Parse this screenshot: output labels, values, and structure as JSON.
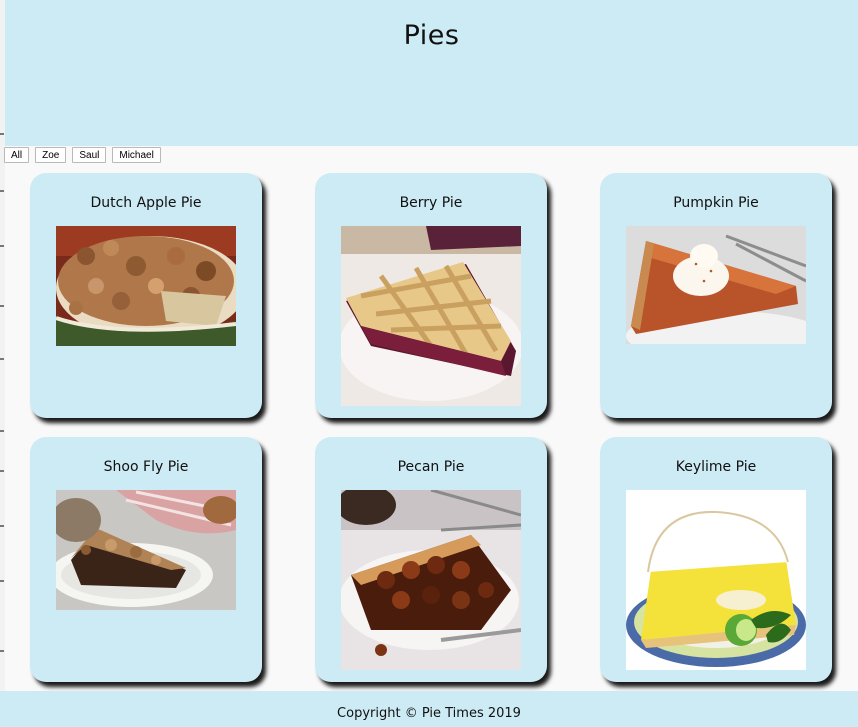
{
  "header": {
    "title": "Pies"
  },
  "filters": [
    "All",
    "Zoe",
    "Saul",
    "Michael"
  ],
  "pies": [
    {
      "name": "Dutch Apple Pie"
    },
    {
      "name": "Berry Pie"
    },
    {
      "name": "Pumpkin Pie"
    },
    {
      "name": "Shoo Fly Pie"
    },
    {
      "name": "Pecan Pie"
    },
    {
      "name": "Keylime Pie"
    }
  ],
  "footer": {
    "copyright": "Copyright © Pie Times 2019"
  },
  "colors": {
    "header_bg": "#cdebf5",
    "card_bg": "#cdebf5",
    "page_bg": "#f9f9f9"
  }
}
